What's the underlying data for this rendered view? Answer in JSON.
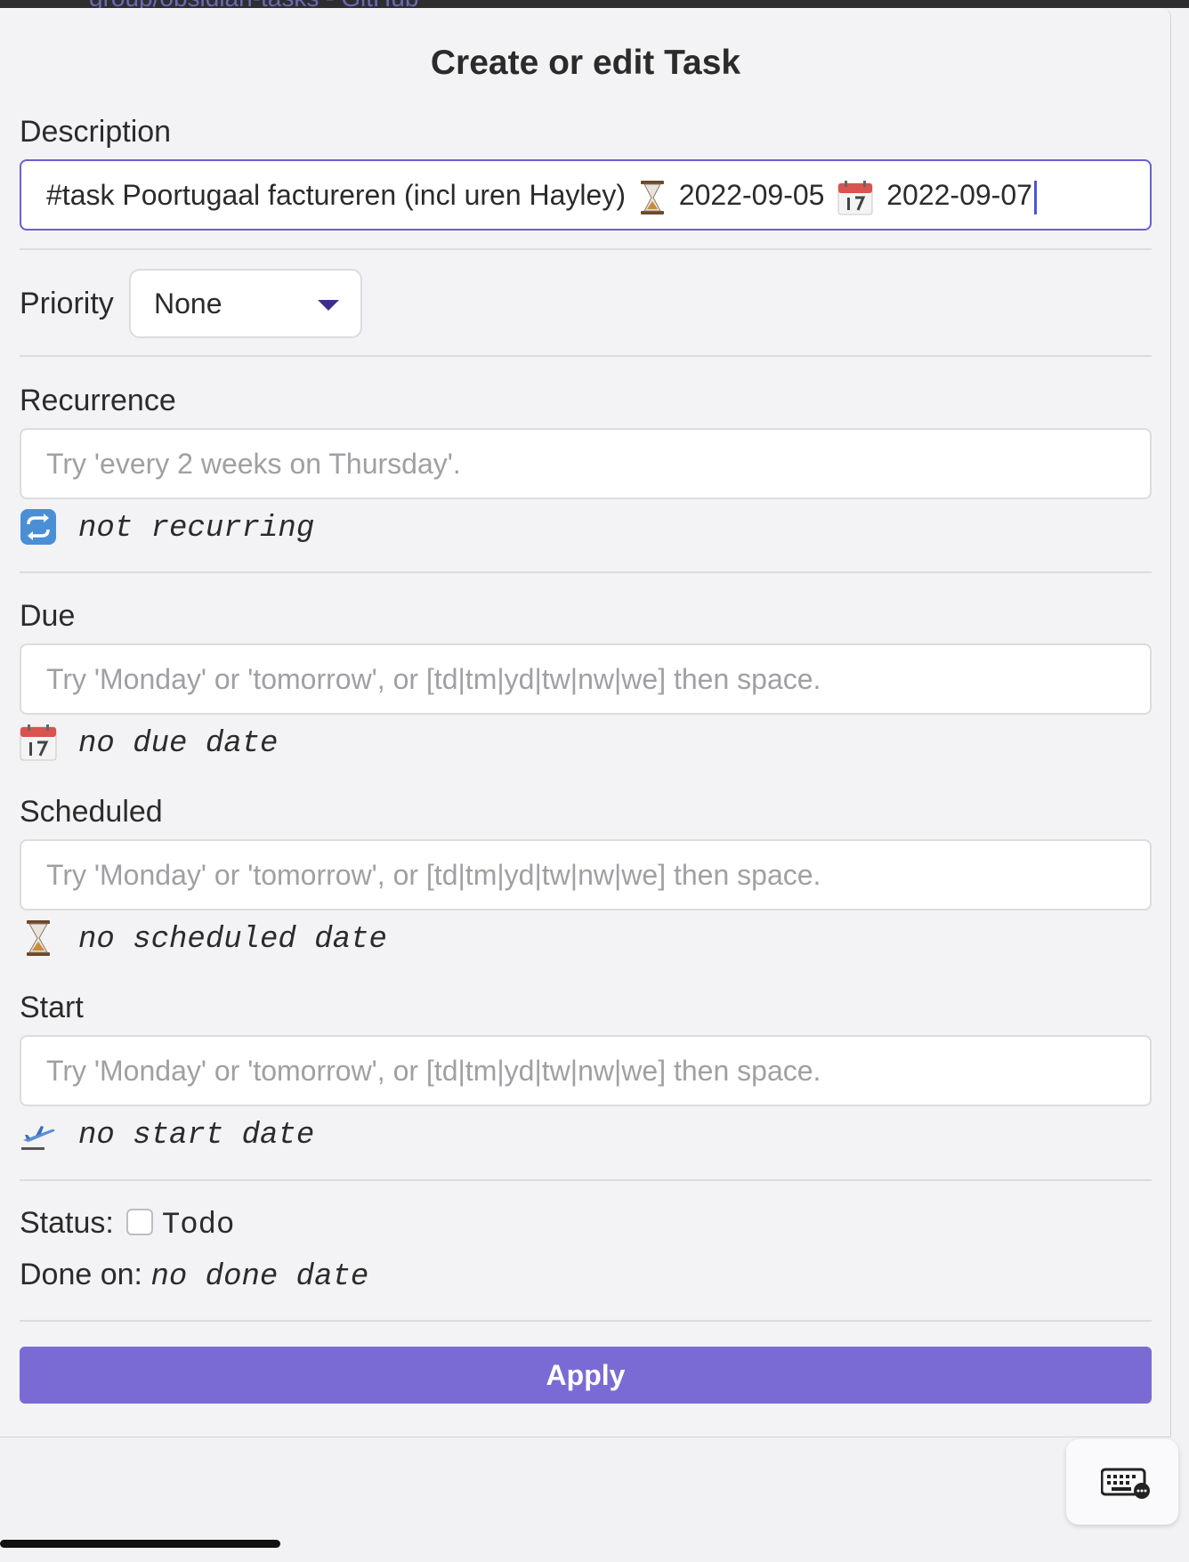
{
  "background_page": {
    "link_text": "group/obsidian-tasks - GitHub"
  },
  "modal": {
    "title": "Create or edit Task",
    "description": {
      "label": "Description",
      "value_text": "#task Poortugaal factureren (incl uren Hayley)",
      "scheduled_date": "2022-09-05",
      "due_date": "2022-09-07"
    },
    "priority": {
      "label": "Priority",
      "selected": "None"
    },
    "recurrence": {
      "label": "Recurrence",
      "placeholder": "Try 'every 2 weeks on Thursday'.",
      "info": "not recurring"
    },
    "due": {
      "label": "Due",
      "placeholder": "Try 'Monday' or 'tomorrow', or [td|tm|yd|tw|nw|we] then space.",
      "info": "no due date"
    },
    "scheduled": {
      "label": "Scheduled",
      "placeholder": "Try 'Monday' or 'tomorrow', or [td|tm|yd|tw|nw|we] then space.",
      "info": "no scheduled date"
    },
    "start": {
      "label": "Start",
      "placeholder": "Try 'Monday' or 'tomorrow', or [td|tm|yd|tw|nw|we] then space.",
      "info": "no start date"
    },
    "status": {
      "label": "Status:",
      "value": "Todo",
      "checked": false
    },
    "done_on": {
      "label": "Done on:",
      "value": "no done date"
    },
    "apply_label": "Apply"
  },
  "colors": {
    "accent": "#7a6bd4",
    "active_border": "#6b5fd0",
    "caret": "#4a56d8"
  },
  "icons": [
    "hourglass-icon",
    "calendar-icon",
    "repeat-icon",
    "airplane-departure-icon",
    "keyboard-icon"
  ]
}
